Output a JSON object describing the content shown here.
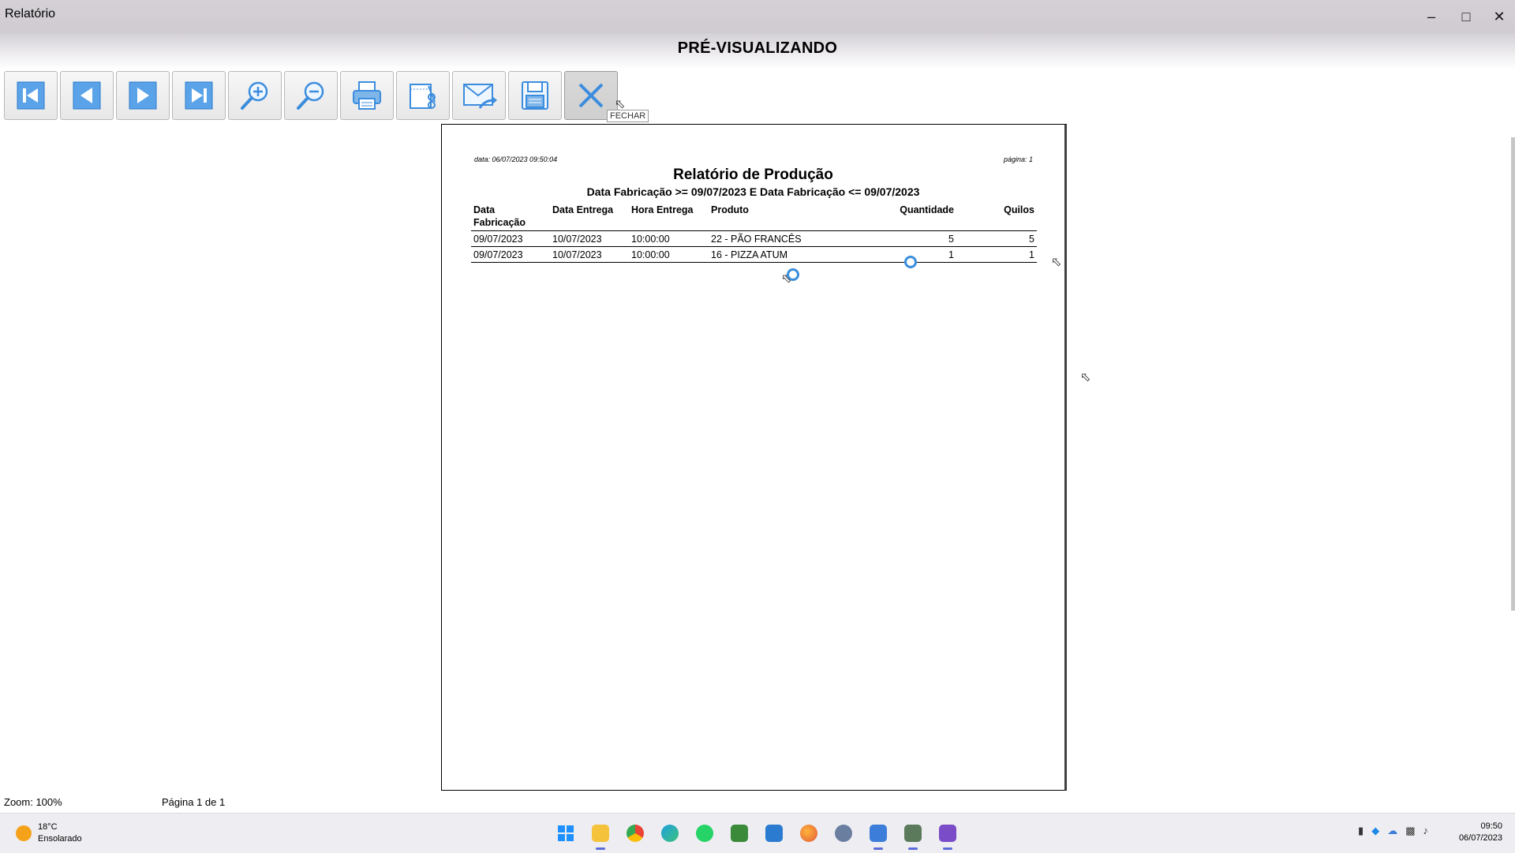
{
  "window": {
    "title": "Relatório",
    "minimize_icon": "minimize-icon",
    "maximize_icon": "maximize-icon",
    "close_icon": "close-icon"
  },
  "header": {
    "caption": "PRÉ-VISUALIZANDO"
  },
  "toolbar": {
    "buttons": [
      {
        "name": "first-page-button",
        "icon": "first-page-icon"
      },
      {
        "name": "previous-page-button",
        "icon": "previous-page-icon"
      },
      {
        "name": "next-page-button",
        "icon": "next-page-icon"
      },
      {
        "name": "last-page-button",
        "icon": "last-page-icon"
      },
      {
        "name": "zoom-in-button",
        "icon": "zoom-in-icon"
      },
      {
        "name": "zoom-out-button",
        "icon": "zoom-out-icon"
      },
      {
        "name": "print-button",
        "icon": "printer-icon"
      },
      {
        "name": "page-setup-button",
        "icon": "page-setup-icon"
      },
      {
        "name": "email-button",
        "icon": "email-icon"
      },
      {
        "name": "save-button",
        "icon": "floppy-disk-icon"
      },
      {
        "name": "close-report-button",
        "icon": "close-x-icon"
      }
    ],
    "tooltip": "FECHAR"
  },
  "report": {
    "date_label": "data: 06/07/2023 09:50:04",
    "page_label": "página: 1",
    "title": "Relatório de Produção",
    "subtitle": "Data Fabricação >= 09/07/2023 E Data Fabricação <= 09/07/2023",
    "columns": [
      "Data Fabricação",
      "Data Entrega",
      "Hora Entrega",
      "Produto",
      "Quantidade",
      "Quilos"
    ],
    "rows": [
      [
        "09/07/2023",
        "10/07/2023",
        "10:00:00",
        "22 - PÃO FRANCÊS",
        "5",
        "5"
      ],
      [
        "09/07/2023",
        "10/07/2023",
        "10:00:00",
        "16 - PIZZA ATUM",
        "1",
        "1"
      ]
    ]
  },
  "status": {
    "zoom": "Zoom: 100%",
    "page": "Página 1 de 1"
  },
  "taskbar": {
    "weather_temp": "18°C",
    "weather_desc": "Ensolarado",
    "apps": [
      "windows-start-icon",
      "file-explorer-icon",
      "chrome-icon",
      "edge-icon",
      "whatsapp-icon",
      "spreadsheet-icon",
      "remote-app-icon",
      "firefox-icon",
      "settings-icon",
      "notepad-icon",
      "erp-app-icon",
      "video-app-icon"
    ],
    "tray_icons": [
      "usb-icon",
      "shield-icon",
      "cloud-icon",
      "network-icon",
      "volume-icon"
    ],
    "time": "09:50",
    "date": "06/07/2023"
  },
  "colors": {
    "toolbar_icon_blue": "#3c8dde",
    "spinner_blue": "#3b8edb"
  }
}
